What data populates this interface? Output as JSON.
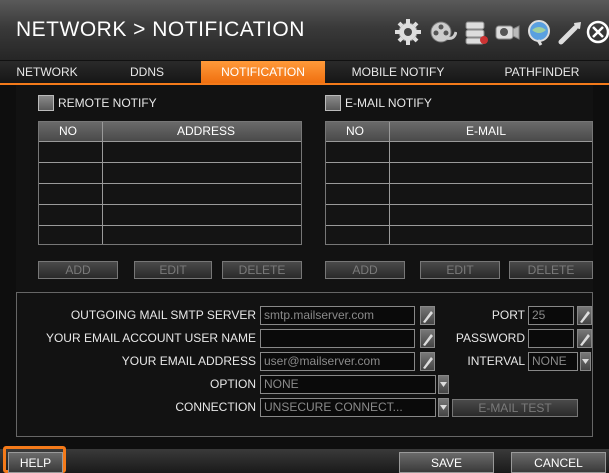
{
  "window": {
    "title": "NETWORK > NOTIFICATION",
    "icons": [
      "gear-icon",
      "film-reel-icon",
      "storage-icon",
      "camera-icon",
      "network-globe-icon",
      "tools-icon",
      "close-icon"
    ],
    "accent_color": "#f47a1a"
  },
  "tabs": [
    {
      "label": "NETWORK",
      "active": false
    },
    {
      "label": "DDNS",
      "active": false
    },
    {
      "label": "NOTIFICATION",
      "active": true
    },
    {
      "label": "MOBILE NOTIFY",
      "active": false
    },
    {
      "label": "PATHFINDER",
      "active": false
    }
  ],
  "remote_notify": {
    "label": "REMOTE NOTIFY",
    "checked": false,
    "columns": [
      "NO",
      "ADDRESS"
    ],
    "rows": 5,
    "buttons": {
      "add": "ADD",
      "edit": "EDIT",
      "delete": "DELETE"
    }
  },
  "email_notify": {
    "label": "E-MAIL NOTIFY",
    "checked": false,
    "columns": [
      "NO",
      "E-MAIL"
    ],
    "rows": 5,
    "buttons": {
      "add": "ADD",
      "edit": "EDIT",
      "delete": "DELETE"
    }
  },
  "mail_settings": {
    "smtp_server_label": "OUTGOING MAIL SMTP SERVER",
    "smtp_server_value": "smtp.mailserver.com",
    "port_label": "PORT",
    "port_value": "25",
    "user_name_label": "YOUR EMAIL ACCOUNT USER NAME",
    "user_name_value": "",
    "password_label": "PASSWORD",
    "password_value": "",
    "email_address_label": "YOUR EMAIL ADDRESS",
    "email_address_value": "user@mailserver.com",
    "interval_label": "INTERVAL",
    "interval_value": "NONE",
    "option_label": "OPTION",
    "option_value": "NONE",
    "connection_label": "CONNECTION",
    "connection_value": "UNSECURE CONNECT...",
    "email_test_label": "E-MAIL TEST"
  },
  "footer": {
    "help_label": "HELP",
    "save_label": "SAVE",
    "cancel_label": "CANCEL"
  }
}
